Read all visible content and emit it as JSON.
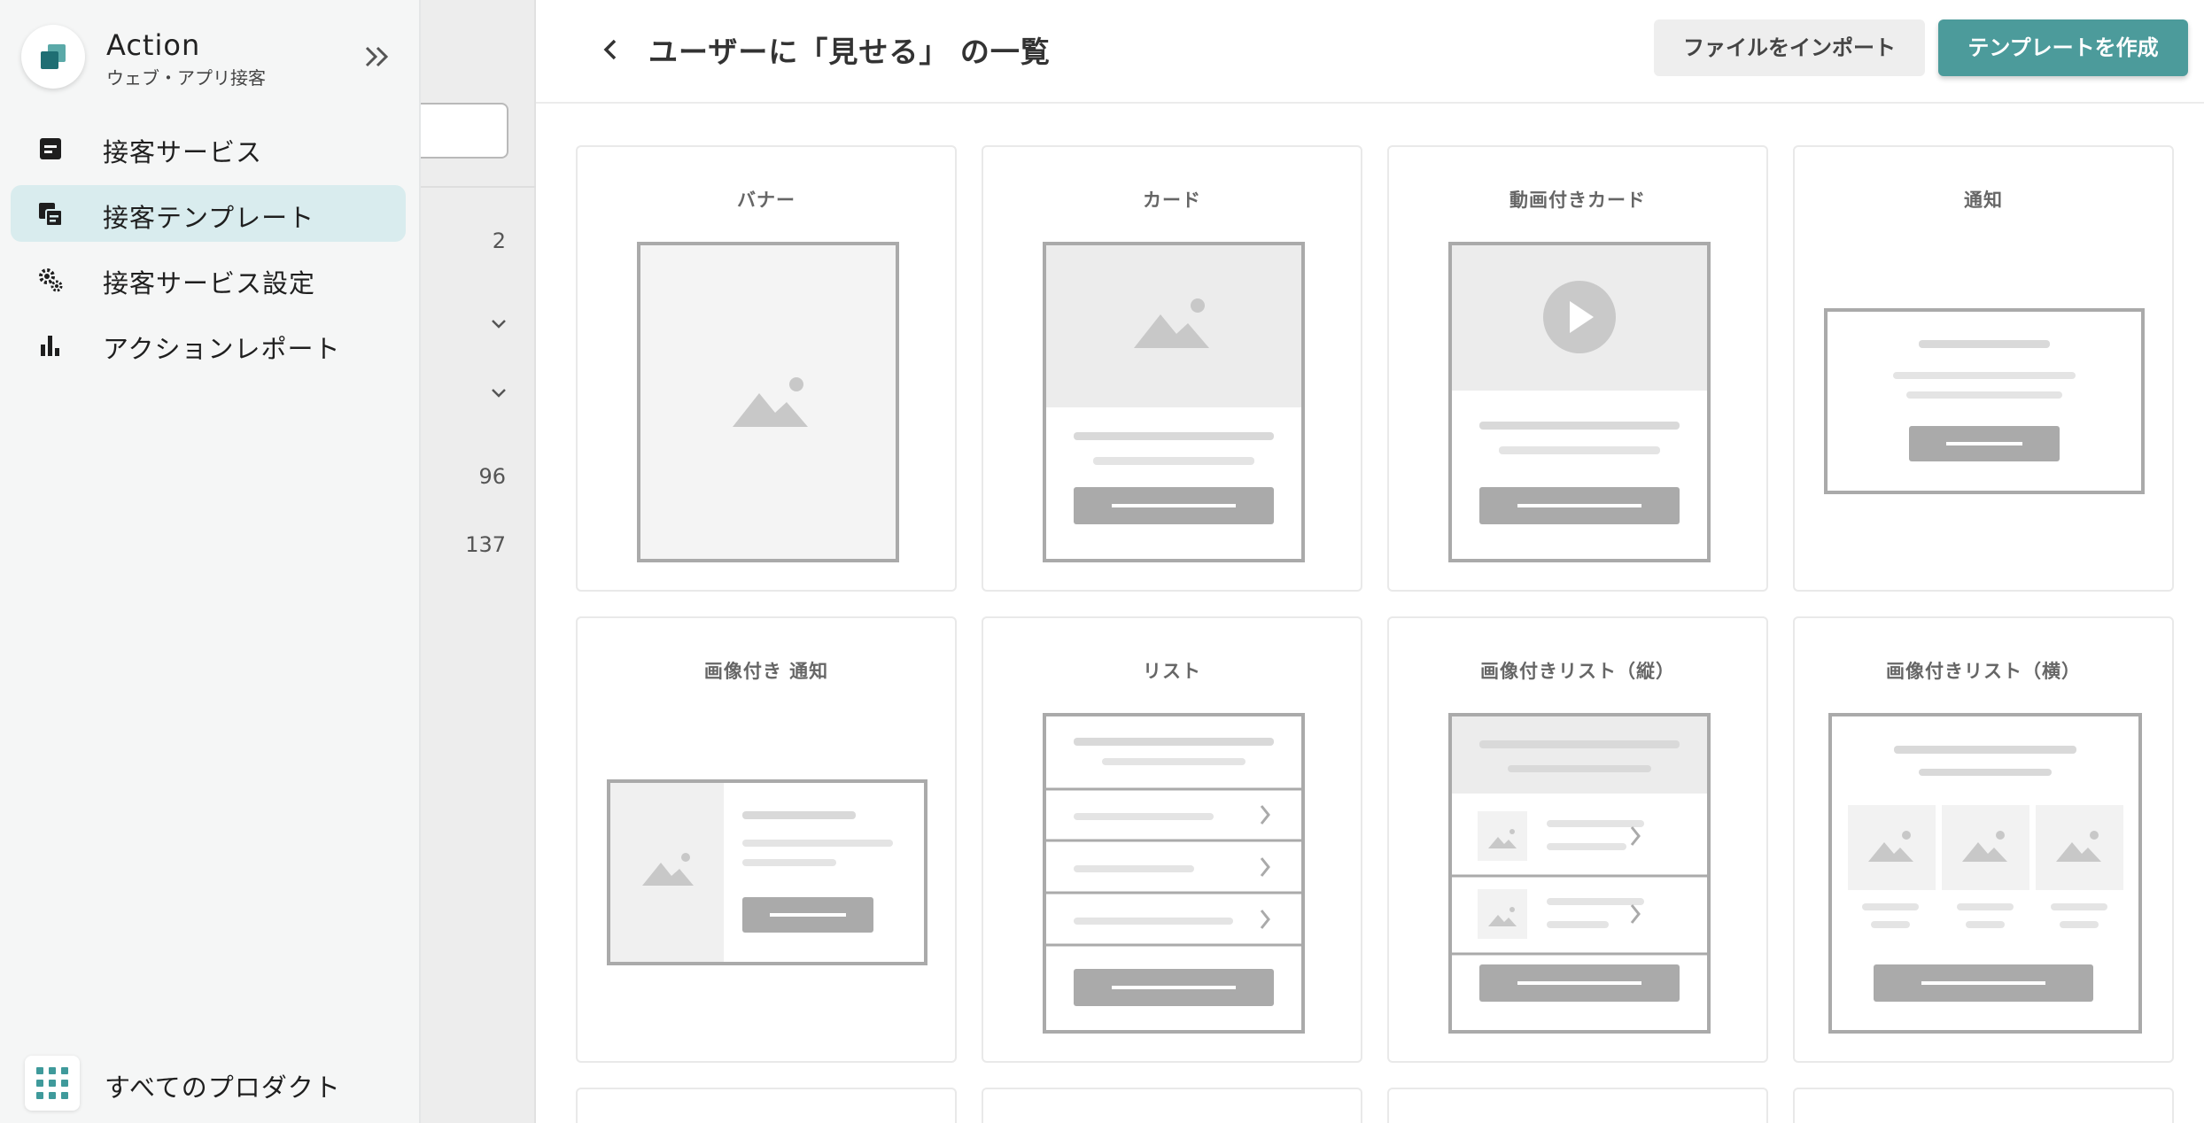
{
  "nav": {
    "brand_title": "Action",
    "brand_subtitle": "ウェブ・アプリ接客",
    "brand_icon": "action-logo-icon",
    "collapse_icon": "double-chevron-right-icon",
    "items": [
      {
        "label": "接客サービス",
        "icon": "service-doc-icon",
        "active": false
      },
      {
        "label": "接客テンプレート",
        "icon": "template-icon",
        "active": true
      },
      {
        "label": "接客サービス設定",
        "icon": "gears-icon",
        "active": false
      },
      {
        "label": "アクションレポート",
        "icon": "bar-chart-icon",
        "active": false
      }
    ],
    "all_products_label": "すべてのプロダクト",
    "all_products_icon": "grid-dots-icon"
  },
  "middle": {
    "counts": [
      "2",
      "96",
      "137"
    ]
  },
  "header": {
    "back_icon": "chevron-left-icon",
    "title": "ユーザーに「見せる」 の一覧",
    "import_label": "ファイルをインポート",
    "create_label": "テンプレートを作成"
  },
  "templates": [
    {
      "label": "バナー",
      "preview": "banner"
    },
    {
      "label": "カード",
      "preview": "card"
    },
    {
      "label": "動画付きカード",
      "preview": "video-card"
    },
    {
      "label": "通知",
      "preview": "notification"
    },
    {
      "label": "画像付き 通知",
      "preview": "image-notification"
    },
    {
      "label": "リスト",
      "preview": "list"
    },
    {
      "label": "画像付きリスト（縦）",
      "preview": "image-list-vertical"
    },
    {
      "label": "画像付きリスト（横）",
      "preview": "image-list-horizontal"
    }
  ],
  "colors": {
    "accent": "#4c9b9b",
    "active_bg": "#d9ecee",
    "preview_gray": "#aaaaaa",
    "preview_light": "#e6e6e6"
  }
}
